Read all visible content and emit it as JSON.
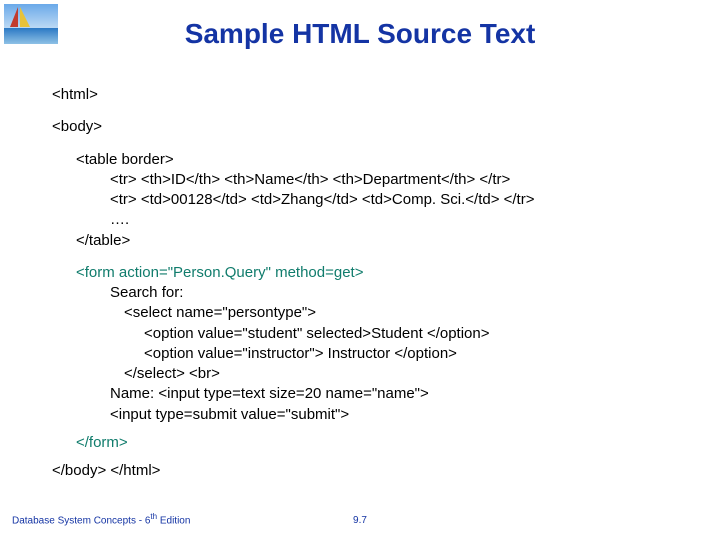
{
  "title": "Sample HTML Source Text",
  "code": {
    "l01": "<html>",
    "l02": "<body>",
    "l03": "<table border>",
    "l04": "<tr> <th>ID</th> <th>Name</th> <th>Department</th> </tr>",
    "l05": "<tr> <td>00128</td> <td>Zhang</td> <td>Comp. Sci.</td> </tr>",
    "l06": "….",
    "l07": "</table>",
    "l08": "<form action=\"Person.Query\" method=get>",
    "l09": "Search for:",
    "l10": "<select name=\"persontype\">",
    "l11": "<option value=\"student\" selected>Student </option>",
    "l12": "<option value=\"instructor\"> Instructor </option>",
    "l13": "</select> <br>",
    "l14": "Name: <input type=text size=20 name=\"name\">",
    "l15": "<input type=submit value=\"submit\">",
    "l16": "</form>",
    "l17": "</body> </html>"
  },
  "footer": {
    "left_prefix": "Database System Concepts - 6",
    "left_sup": "th",
    "left_suffix": " Edition",
    "center": "9.7"
  }
}
